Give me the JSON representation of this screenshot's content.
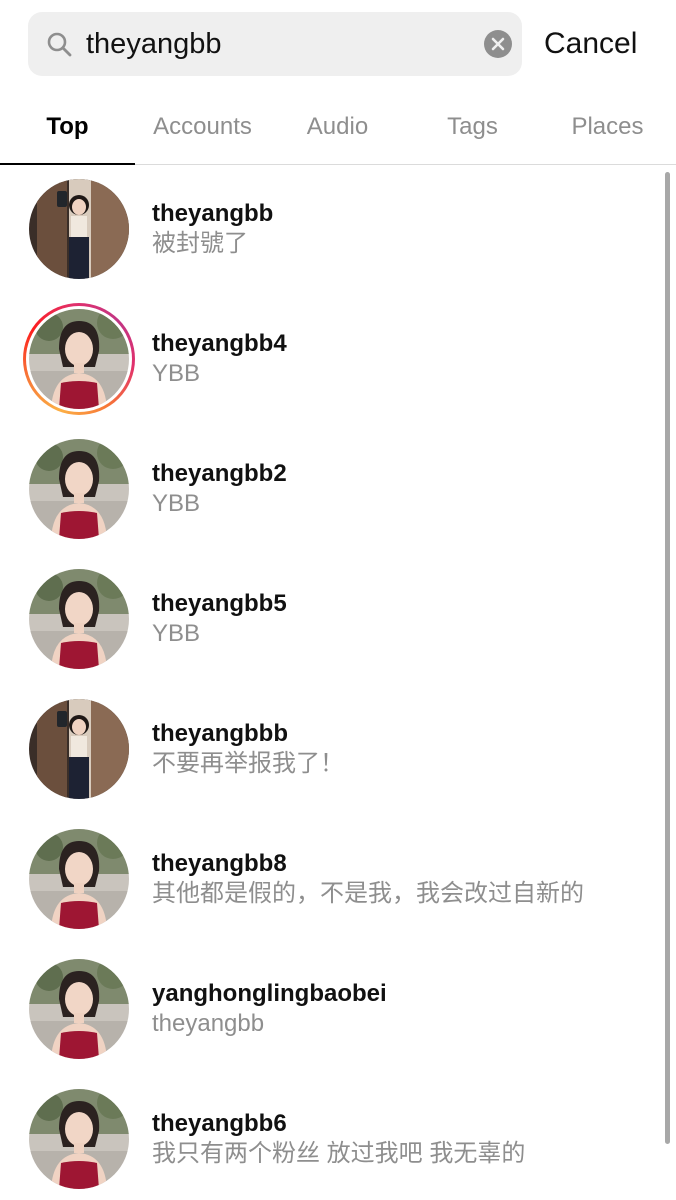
{
  "search": {
    "query": "theyangbb",
    "cancel_label": "Cancel",
    "icons": {
      "search": "search-icon",
      "clear": "clear-circle-icon"
    }
  },
  "tabs": [
    {
      "label": "Top",
      "active": true
    },
    {
      "label": "Accounts",
      "active": false
    },
    {
      "label": "Audio",
      "active": false
    },
    {
      "label": "Tags",
      "active": false
    },
    {
      "label": "Places",
      "active": false
    }
  ],
  "results": [
    {
      "username": "theyangbb",
      "subtitle": "被封號了",
      "avatar": "mirror-selfie",
      "story": false
    },
    {
      "username": "theyangbb4",
      "subtitle": "YBB",
      "avatar": "portrait-red-dress",
      "story": true
    },
    {
      "username": "theyangbb2",
      "subtitle": "YBB",
      "avatar": "portrait-red-dress",
      "story": false
    },
    {
      "username": "theyangbb5",
      "subtitle": "YBB",
      "avatar": "portrait-red-dress",
      "story": false
    },
    {
      "username": "theyangbbb",
      "subtitle": "不要再举报我了！",
      "avatar": "mirror-selfie",
      "story": false
    },
    {
      "username": "theyangbb8",
      "subtitle": "其他都是假的，不是我，我会改过自新的",
      "avatar": "portrait-red-dress",
      "story": false
    },
    {
      "username": "yanghonglingbaobei",
      "subtitle": "theyangbb",
      "avatar": "portrait-red-dress",
      "story": false
    },
    {
      "username": "theyangbb6",
      "subtitle": "我只有两个粉丝 放过我吧 我无辜的",
      "avatar": "portrait-red-dress",
      "story": false
    }
  ],
  "colors": {
    "accent_text": "#000000",
    "secondary_text": "#8e8e8e",
    "search_bg": "#efefef",
    "dress_red": "#9e1633"
  }
}
